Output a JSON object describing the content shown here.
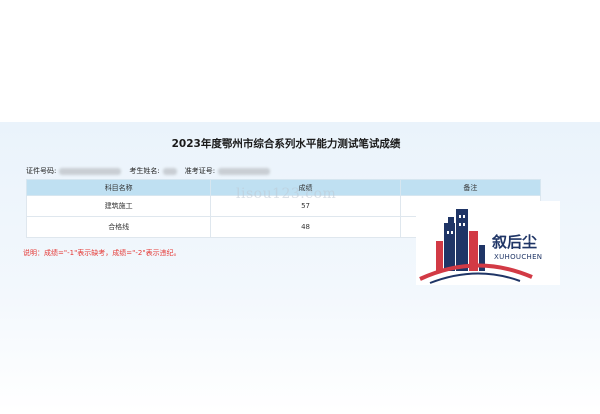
{
  "title": "2023年度鄂州市综合系列水平能力测试笔试成绩",
  "info": {
    "id_label": "证件号码:",
    "name_label": "考生姓名:",
    "ticket_label": "准考证号:"
  },
  "table": {
    "headers": [
      "科目名称",
      "成绩",
      "备注"
    ],
    "rows": [
      {
        "subject": "建筑施工",
        "score": "57",
        "note": ""
      },
      {
        "subject": "合格线",
        "score": "48",
        "note": ""
      }
    ]
  },
  "note": "说明：成绩=\"-1\"表示缺考，成绩=\"-2\"表示违纪。",
  "watermark": "lisou123.com",
  "logo": {
    "name_cn": "叙后尘",
    "name_en": "XUHOUCHEN",
    "colors": {
      "navy": "#1f3566",
      "red": "#d23a45"
    }
  }
}
